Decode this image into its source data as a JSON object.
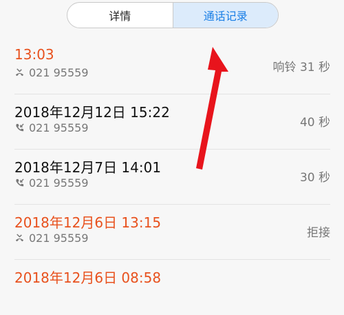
{
  "tabs": [
    {
      "label": "详情",
      "active": false
    },
    {
      "label": "通话记录",
      "active": true
    }
  ],
  "colors": {
    "accent": "#1a7fe6",
    "missed": "#e8511d",
    "arrow": "#e8141c"
  },
  "calls": [
    {
      "time": "13:03",
      "number": "021 95559",
      "status": "响铃 31 秒",
      "type": "missed",
      "icon": "missed-call-icon"
    },
    {
      "time": "2018年12月12日 15:22",
      "number": "021 95559",
      "status": "40 秒",
      "type": "answered",
      "icon": "incoming-call-icon"
    },
    {
      "time": "2018年12月7日 14:01",
      "number": "021 95559",
      "status": "30 秒",
      "type": "answered",
      "icon": "incoming-call-icon"
    },
    {
      "time": "2018年12月6日 13:15",
      "number": "021 95559",
      "status": "拒接",
      "type": "missed",
      "icon": "rejected-call-icon"
    },
    {
      "time": "2018年12月6日 08:58",
      "number": "",
      "status": "",
      "type": "missed",
      "icon": ""
    }
  ]
}
